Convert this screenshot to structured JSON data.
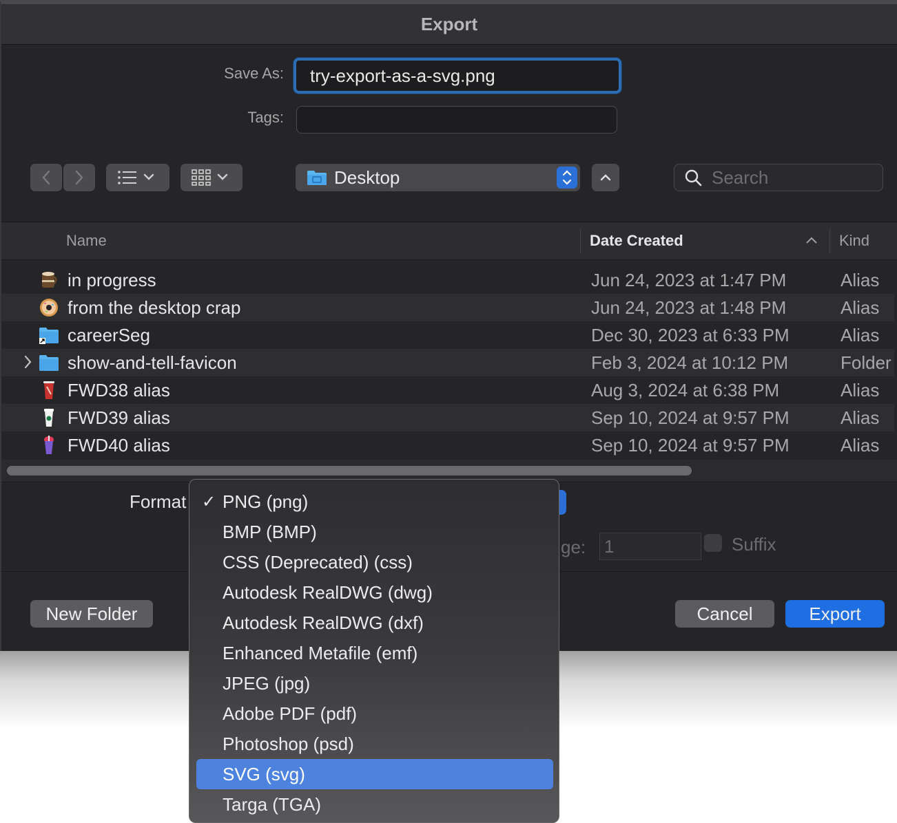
{
  "window": {
    "title": "Export"
  },
  "save_as": {
    "label": "Save As:",
    "value": "try-export-as-a-svg.png"
  },
  "tags": {
    "label": "Tags:",
    "value": ""
  },
  "toolbar": {
    "location": "Desktop",
    "search_placeholder": "Search"
  },
  "columns": {
    "name": "Name",
    "date": "Date Created",
    "kind": "Kind"
  },
  "files": [
    {
      "name": "in progress",
      "date": "Jun 24, 2023 at 1:47 PM",
      "kind": "Alias",
      "icon": "mug-icon"
    },
    {
      "name": "from the desktop crap",
      "date": "Jun 24, 2023 at 1:48 PM",
      "kind": "Alias",
      "icon": "donut-icon"
    },
    {
      "name": "careerSeg",
      "date": "Dec 30, 2023 at 6:33 PM",
      "kind": "Alias",
      "icon": "folder-alias-icon"
    },
    {
      "name": "show-and-tell-favicon",
      "date": "Feb 3, 2024 at 10:12 PM",
      "kind": "Folder",
      "icon": "folder-icon"
    },
    {
      "name": "FWD38 alias",
      "date": "Aug 3, 2024 at 6:38 PM",
      "kind": "Alias",
      "icon": "red-cup-icon"
    },
    {
      "name": "FWD39 alias",
      "date": "Sep 10, 2024 at 9:57 PM",
      "kind": "Alias",
      "icon": "white-cup-icon"
    },
    {
      "name": "FWD40 alias",
      "date": "Sep 10, 2024 at 9:57 PM",
      "kind": "Alias",
      "icon": "slush-cup-icon"
    }
  ],
  "options": {
    "format_label": "Format",
    "page_label_partial": "ge:",
    "page_value": "1",
    "suffix_label": "Suffix"
  },
  "buttons": {
    "new_folder": "New Folder",
    "cancel": "Cancel",
    "export": "Export"
  },
  "format_menu": {
    "checked": "PNG (png)",
    "highlighted": "SVG (svg)",
    "items": [
      "PNG (png)",
      "BMP (BMP)",
      "CSS (Deprecated) (css)",
      "Autodesk RealDWG (dwg)",
      "Autodesk RealDWG (dxf)",
      "Enhanced Metafile (emf)",
      "JPEG (jpg)",
      "Adobe PDF (pdf)",
      "Photoshop (psd)",
      "SVG (svg)",
      "Targa (TGA)"
    ]
  }
}
